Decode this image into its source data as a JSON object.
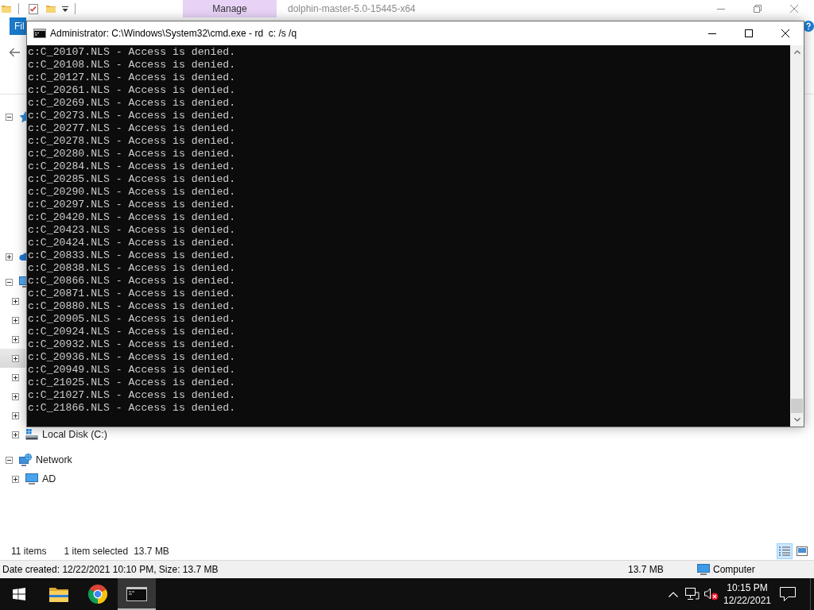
{
  "explorer": {
    "title": "dolphin-master-5.0-15445-x64",
    "contextual_tab": {
      "label": "Manage"
    },
    "file_tab": {
      "label": "Fil"
    },
    "nav_tree": [
      {
        "kind": "quick-access",
        "expanded": true,
        "selected": false
      },
      {
        "kind": "cloud",
        "expanded": false,
        "selected": false
      },
      {
        "kind": "pc",
        "expanded": true,
        "selected": false,
        "children": [
          {
            "expanded": false,
            "selected": false
          },
          {
            "expanded": false,
            "selected": false
          },
          {
            "expanded": false,
            "selected": false
          },
          {
            "expanded": false,
            "selected": true
          },
          {
            "expanded": false,
            "selected": false
          },
          {
            "expanded": false,
            "selected": false
          },
          {
            "expanded": false,
            "selected": false
          },
          {
            "kind": "drive",
            "label": "Local Disk (C:)",
            "expanded": false,
            "selected": false
          }
        ]
      },
      {
        "kind": "network",
        "label": "Network",
        "expanded": true,
        "selected": false,
        "children": [
          {
            "kind": "computer",
            "label": "AD",
            "expanded": false,
            "selected": false
          }
        ]
      }
    ],
    "status_bar": {
      "item_count": "11 items",
      "selection": "1 item selected",
      "selection_size": "13.7 MB",
      "view_buttons": [
        {
          "kind": "details",
          "selected": true
        },
        {
          "kind": "large-icons",
          "selected": false
        }
      ]
    },
    "details_bar": {
      "summary": "Date created: 12/22/2021 10:10 PM, Size: 13.7 MB",
      "size": "13.7 MB",
      "location": "Computer"
    }
  },
  "console_window": {
    "title": "Administrator: C:\\Windows\\System32\\cmd.exe - rd  c: /s /q",
    "lines": [
      "c:C_20107.NLS - Access is denied.",
      "c:C_20108.NLS - Access is denied.",
      "c:C_20127.NLS - Access is denied.",
      "c:C_20261.NLS - Access is denied.",
      "c:C_20269.NLS - Access is denied.",
      "c:C_20273.NLS - Access is denied.",
      "c:C_20277.NLS - Access is denied.",
      "c:C_20278.NLS - Access is denied.",
      "c:C_20280.NLS - Access is denied.",
      "c:C_20284.NLS - Access is denied.",
      "c:C_20285.NLS - Access is denied.",
      "c:C_20290.NLS - Access is denied.",
      "c:C_20297.NLS - Access is denied.",
      "c:C_20420.NLS - Access is denied.",
      "c:C_20423.NLS - Access is denied.",
      "c:C_20424.NLS - Access is denied.",
      "c:C_20833.NLS - Access is denied.",
      "c:C_20838.NLS - Access is denied.",
      "c:C_20866.NLS - Access is denied.",
      "c:C_20871.NLS - Access is denied.",
      "c:C_20880.NLS - Access is denied.",
      "c:C_20905.NLS - Access is denied.",
      "c:C_20924.NLS - Access is denied.",
      "c:C_20932.NLS - Access is denied.",
      "c:C_20936.NLS - Access is denied.",
      "c:C_20949.NLS - Access is denied.",
      "c:C_21025.NLS - Access is denied.",
      "c:C_21027.NLS - Access is denied.",
      "c:C_21866.NLS - Access is denied."
    ]
  },
  "taskbar": {
    "apps": [
      {
        "kind": "file-explorer",
        "active": false
      },
      {
        "kind": "browser",
        "active": false
      },
      {
        "kind": "console",
        "active": true
      }
    ],
    "clock": {
      "time": "10:15 PM",
      "date": "12/22/2021"
    }
  }
}
